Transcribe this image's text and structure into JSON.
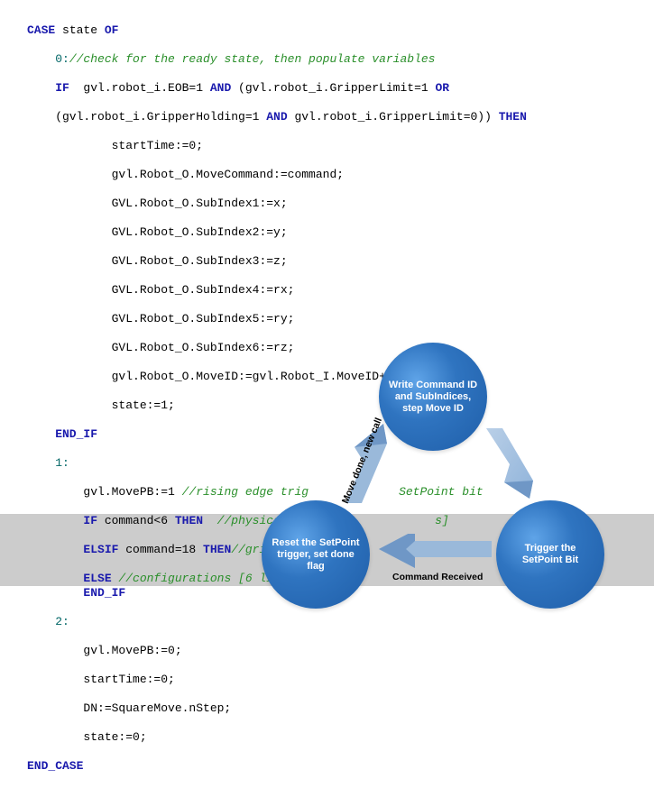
{
  "code": {
    "l01_a": "CASE",
    "l01_b": " state ",
    "l01_c": "OF",
    "l02_a": "    0:",
    "l02_b": "//check for the ready state, then populate variables",
    "l03_a": "    IF",
    "l03_b": "  gvl.robot_i.EOB=1 ",
    "l03_c": "AND",
    "l03_d": " (gvl.robot_i.GripperLimit=1 ",
    "l03_e": "OR",
    "l04_a": "    (gvl.robot_i.GripperHolding=1 ",
    "l04_b": "AND",
    "l04_c": " gvl.robot_i.GripperLimit=0)) ",
    "l04_d": "THEN",
    "l05": "            startTime:=0;",
    "l06": "            gvl.Robot_O.MoveCommand:=command;",
    "l07": "            GVL.Robot_O.SubIndex1:=x;",
    "l08": "            GVL.Robot_O.SubIndex2:=y;",
    "l09": "            GVL.Robot_O.SubIndex3:=z;",
    "l10": "            GVL.Robot_O.SubIndex4:=rx;",
    "l11": "            GVL.Robot_O.SubIndex5:=ry;",
    "l12": "            GVL.Robot_O.SubIndex6:=rz;",
    "l13": "            gvl.Robot_O.MoveID:=gvl.Robot_I.MoveID+1;",
    "l14": "            state:=1;",
    "l15": "    END_IF",
    "l16": "    1:",
    "l17_a": "        gvl.MovePB:=1 ",
    "l17_b": "//rising edge trig",
    "l17_c": "SetPoint bit",
    "l18_a": "        IF",
    "l18_b": " command<6 ",
    "l18_c": "THEN",
    "l18_d": "  //physical mo",
    "l18_e": "s]",
    "l19_a": "        ELSIF",
    "l19_b": " command=18 ",
    "l19_c": "THEN",
    "l19_d": "//gripper",
    "l20_a": "        ELSE",
    "l20_b": " //configurations [6 lines",
    "l21": "        END_IF",
    "l22": "    2:",
    "l23": "        gvl.MovePB:=0;",
    "l24": "        startTime:=0;",
    "l25": "        DN:=SquareMove.nStep;",
    "l26": "        state:=0;",
    "l27": "END_CASE"
  },
  "diagram": {
    "node_top": "Write Command ID and SubIndices, step Move ID",
    "node_right": "Trigger the SetPoint Bit",
    "node_left": "Reset the SetPoint trigger, set done flag",
    "arrow_right_to_left": "Command Received",
    "arrow_left_to_top": "Move done, new call"
  },
  "colors": {
    "circle_fill": "#2f74c0",
    "arrow_fill": "#9ab9da"
  }
}
